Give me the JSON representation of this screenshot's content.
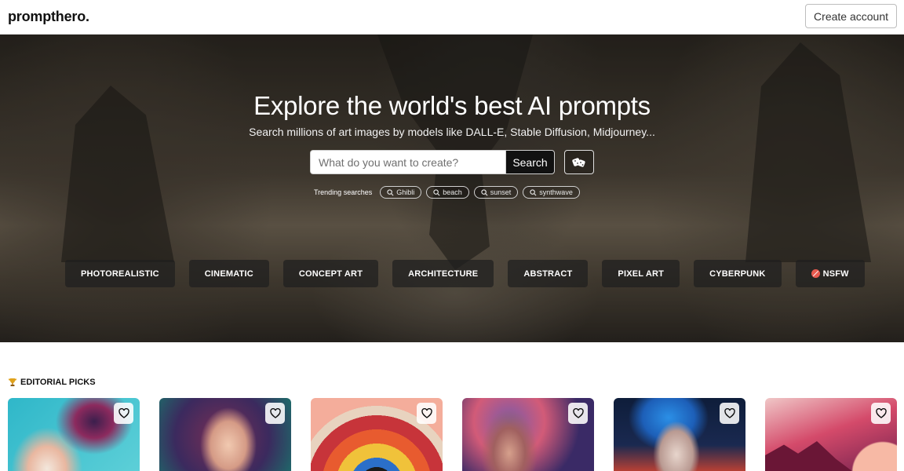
{
  "header": {
    "logo": "prompthero.",
    "create_account": "Create account"
  },
  "hero": {
    "title": "Explore the world's best AI prompts",
    "subtitle": "Search millions of art images by models like DALL-E, Stable Diffusion, Midjourney...",
    "search": {
      "placeholder": "What do you want to create?",
      "button": "Search"
    },
    "random_icon": "dice-icon",
    "trending_label": "Trending searches",
    "trending": [
      "Ghibli",
      "beach",
      "sunset",
      "synthwave"
    ]
  },
  "categories": [
    "PHOTOREALISTIC",
    "CINEMATIC",
    "CONCEPT ART",
    "ARCHITECTURE",
    "ABSTRACT",
    "PIXEL ART",
    "CYBERPUNK",
    "NSFW"
  ],
  "editorial": {
    "icon": "trophy-icon",
    "heading": "EDITORIAL PICKS",
    "card_count_visible": 6
  },
  "colors": {
    "search_button": "#111111",
    "nsfw_badge": "#e85a4f",
    "header_border": "#e6e6e6"
  }
}
